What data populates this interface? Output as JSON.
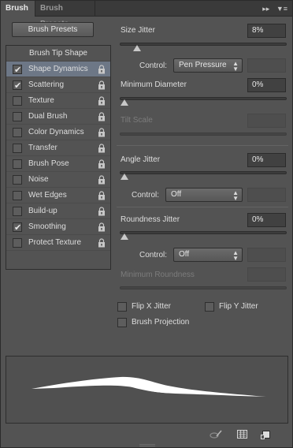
{
  "tabs": {
    "brush": "Brush",
    "brush_presets": "Brush Presets"
  },
  "left": {
    "presets_button": "Brush Presets",
    "tip_shape": "Brush Tip Shape",
    "items": [
      {
        "label": "Shape Dynamics",
        "checked": true,
        "selected": true
      },
      {
        "label": "Scattering",
        "checked": true
      },
      {
        "label": "Texture",
        "checked": false
      },
      {
        "label": "Dual Brush",
        "checked": false
      },
      {
        "label": "Color Dynamics",
        "checked": false
      },
      {
        "label": "Transfer",
        "checked": false
      },
      {
        "label": "Brush Pose",
        "checked": false
      },
      {
        "label": "Noise",
        "checked": false
      },
      {
        "label": "Wet Edges",
        "checked": false
      },
      {
        "label": "Build-up",
        "checked": false
      },
      {
        "label": "Smoothing",
        "checked": true
      },
      {
        "label": "Protect Texture",
        "checked": false
      }
    ]
  },
  "right": {
    "size_jitter": {
      "label": "Size Jitter",
      "value": "8%",
      "slider_fraction": 0.08
    },
    "size_control": {
      "label": "Control:",
      "value": "Pen Pressure"
    },
    "min_diameter": {
      "label": "Minimum Diameter",
      "value": "0%",
      "slider_fraction": 0.0
    },
    "tilt_scale": {
      "label": "Tilt Scale"
    },
    "angle_jitter": {
      "label": "Angle Jitter",
      "value": "0%",
      "slider_fraction": 0.0
    },
    "angle_control": {
      "label": "Control:",
      "value": "Off"
    },
    "roundness_jitter": {
      "label": "Roundness Jitter",
      "value": "0%",
      "slider_fraction": 0.0
    },
    "roundness_control": {
      "label": "Control:",
      "value": "Off"
    },
    "min_roundness": {
      "label": "Minimum Roundness"
    },
    "flip_x": {
      "label": "Flip X Jitter",
      "checked": false
    },
    "flip_y": {
      "label": "Flip Y Jitter",
      "checked": false
    },
    "brush_projection": {
      "label": "Brush Projection",
      "checked": false
    }
  },
  "icons": {
    "panel_menu": "panel-menu-icon",
    "collapse": "collapse-icon",
    "toggle_live_tip": "brush-preview-toggle-icon",
    "grid": "grid-icon",
    "new_preset": "new-preset-icon"
  },
  "colors": {
    "panel_bg": "#535353",
    "selected_row": "#6d7786",
    "field_bg": "#414141"
  }
}
